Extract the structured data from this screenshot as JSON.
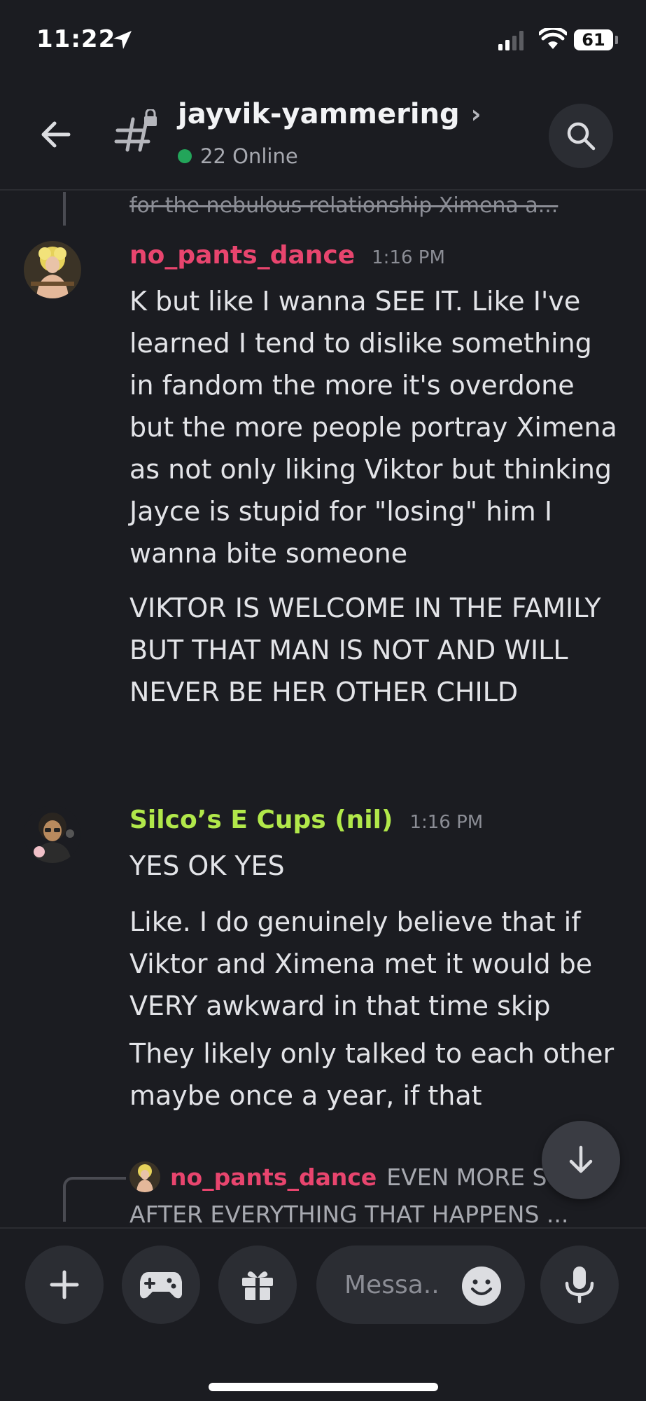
{
  "status_bar": {
    "time": "11:22",
    "battery": "61"
  },
  "header": {
    "channel_name": "jayvik-yammering",
    "online_count": "22 Online"
  },
  "messages": {
    "reply_snippet_top": "for the nebulous relationship Ximena a...",
    "items": [
      {
        "author": "no_pants_dance",
        "time": "1:16 PM",
        "author_color": "#e8456e",
        "paragraphs": [
          "K but like I wanna SEE IT. Like I've learned I tend to dislike something in fandom the more it's overdone but the more people portray Ximena as not only liking Viktor but thinking Jayce is stupid for \"losing\" him I wanna bite someone",
          "VIKTOR IS WELCOME IN THE FAMILY BUT THAT MAN IS NOT AND WILL NEVER BE HER OTHER CHILD"
        ]
      },
      {
        "author": "Silco’s E Cups (nil)",
        "time": "1:16 PM",
        "author_color": "#b1e84a",
        "paragraphs": [
          "YES OK YES",
          "Like. I do genuinely believe that if Viktor and Ximena met it would be VERY awkward in that time skip",
          "They likely only talked to each other maybe once a year, if that"
        ]
      }
    ],
    "reply_preview": {
      "author": "no_pants_dance",
      "snippet": "EVEN MORE S",
      "line2": "AFTER EVERYTHING THAT HAPPENS ..."
    }
  },
  "composer": {
    "placeholder": "Messa.."
  },
  "icons": {
    "back": "arrow-left-icon",
    "channel": "locked-hash-icon",
    "search": "search-icon",
    "jump": "arrow-down-icon",
    "add": "plus-icon",
    "games": "gamepad-icon",
    "gift": "gift-icon",
    "emoji": "smiley-icon",
    "mic": "microphone-icon"
  }
}
